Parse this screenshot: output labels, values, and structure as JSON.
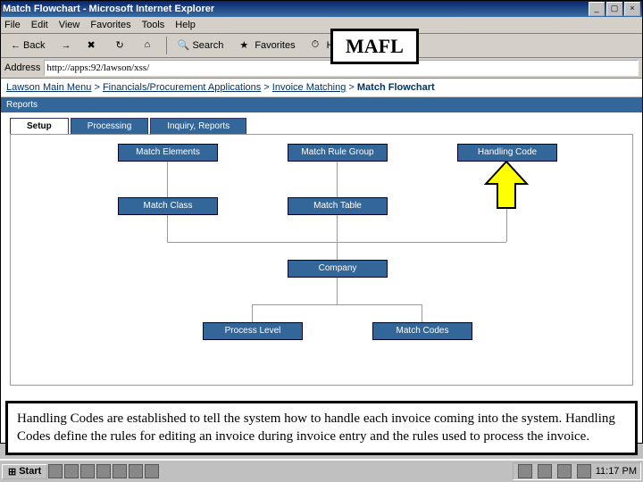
{
  "window": {
    "title": "Match Flowchart - Microsoft Internet Explorer"
  },
  "menu": {
    "file": "File",
    "edit": "Edit",
    "view": "View",
    "favorites": "Favorites",
    "tools": "Tools",
    "help": "Help"
  },
  "tb": {
    "back": "Back",
    "search": "Search",
    "favorites": "Favorites",
    "history": "History"
  },
  "addr": {
    "label": "Address",
    "url": "http://apps:92/lawson/xss/"
  },
  "crumb": {
    "a": "Lawson Main Menu",
    "b": "Financials/Procurement Applications",
    "c": "Invoice Matching",
    "d": "Match Flowchart"
  },
  "reports": "Reports",
  "tabs": {
    "setup": "Setup",
    "processing": "Processing",
    "inquiry": "Inquiry, Reports"
  },
  "boxes": {
    "matchElements": "Match Elements",
    "matchRuleGroup": "Match Rule Group",
    "handlingCode": "Handling Code",
    "matchClass": "Match Class",
    "matchTable": "Match Table",
    "company": "Company",
    "processLevel": "Process Level",
    "matchCodes": "Match Codes"
  },
  "mafl": "MAFL",
  "desc": "Handling Codes are established to tell the system how to handle each invoice coming into the system.  Handling Codes define the rules for editing an invoice during invoice entry and the rules used to process the invoice.",
  "start": "Start",
  "clock": "11:17 PM"
}
